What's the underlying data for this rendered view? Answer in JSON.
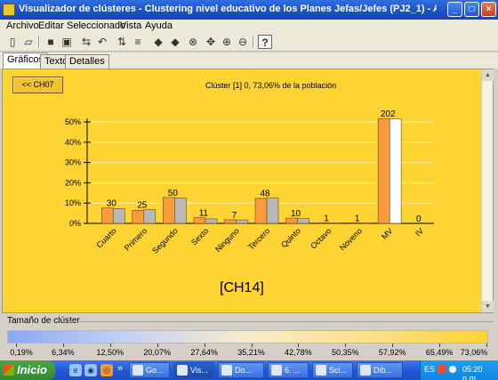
{
  "window": {
    "title": "Visualizador de clústeres - Clustering nivel educativo de los Planes Jefas/Jefes (PJ2_1) - Archivo local: general I...",
    "minimize_icon": "minimize-icon",
    "maximize_icon": "maximize-icon",
    "close_icon": "close-icon"
  },
  "menu": {
    "items": [
      "Archivo",
      "Editar",
      "Seleccionado",
      "Vista",
      "Ayuda"
    ]
  },
  "toolbar": {
    "icons": [
      "new-icon",
      "open-icon",
      "save-icon",
      "print-icon",
      "swap-icon",
      "undo-icon",
      "sort-icon",
      "filter-icon",
      "left-arrow-icon",
      "right-arrow-icon",
      "binoculars-icon",
      "pan-icon",
      "zoom-in-icon",
      "zoom-out-icon",
      "help-icon"
    ],
    "help_glyph": "?"
  },
  "tabs": [
    "Gráficos",
    "Texto",
    "Detalles"
  ],
  "chart_panel": {
    "back_button": "<< CH07",
    "title": "Clúster [1] 0, 73,06% de la población",
    "cluster_label": "[CH14]",
    "background": "#fdd432"
  },
  "chart_data": {
    "type": "bar",
    "title": "Clúster [1] 0, 73,06% de la población",
    "categories": [
      "Cuarto",
      "Primero",
      "Segundo",
      "Sexto",
      "Ninguno",
      "Tercero",
      "Quinto",
      "Octavo",
      "Noveno",
      "MV",
      "IV"
    ],
    "data_labels": [
      "30",
      "25",
      "50",
      "11",
      "7",
      "48",
      "10",
      "1",
      "1",
      "202",
      "0"
    ],
    "series": [
      {
        "values": [
          7.6,
          6.4,
          12.8,
          2.8,
          1.8,
          12.3,
          2.6,
          0.3,
          0.3,
          51.7,
          0.0
        ],
        "color": "#f99a3c"
      },
      {
        "values": [
          7.3,
          6.7,
          12.5,
          2.2,
          1.7,
          12.5,
          2.4,
          0.2,
          0.2,
          51.5,
          0.0
        ],
        "color": "#b8b8b8"
      }
    ],
    "highlight": {
      "category": "MV",
      "second_color": "#ffffff"
    },
    "yticks": [
      "0%",
      "10%",
      "20%",
      "30%",
      "40%",
      "50%"
    ],
    "ylim": [
      0,
      50
    ],
    "grid": true,
    "legend": "none"
  },
  "size_legend": {
    "label": "Tamaño de clúster",
    "ticks": [
      "0,19%",
      "6,34%",
      "12,50%",
      "20,07%",
      "27,64%",
      "35,21%",
      "42,78%",
      "50,35%",
      "57,92%",
      "65,49%",
      "73,06%"
    ],
    "colors": [
      "#8aa8f4",
      "#fdd432"
    ]
  },
  "taskbar": {
    "start": "Inicio",
    "quicklaunch": [
      "ie-icon",
      "media-icon",
      "firefox-icon"
    ],
    "chevron": "»",
    "tasks": [
      "Go...",
      "Vis...",
      "Do...",
      "6. ...",
      "Sci...",
      "Dib..."
    ],
    "tray_lang": "ES",
    "clock": "05:20 p.m."
  }
}
